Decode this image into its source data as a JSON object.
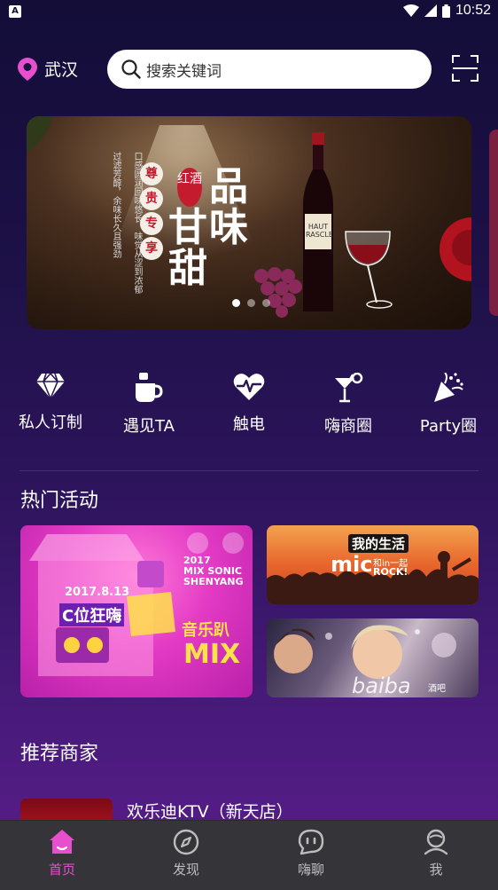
{
  "status_bar": {
    "time": "10:52",
    "notification": "A"
  },
  "header": {
    "location": "武汉",
    "search_placeholder": "搜索关键词"
  },
  "banner": {
    "tag": "红酒",
    "title_chars": [
      "品",
      "味",
      "甘",
      "甜"
    ],
    "circle_chars": [
      "尊",
      "贵",
      "专",
      "享"
    ],
    "side_text_1": "口感圆润回味悠长，味觉从涩到浓郁",
    "side_text_2": "过滤芳醇，余味长久且强劲",
    "bottle_label": "HAUT RASCLE",
    "dot_count": 3,
    "active_dot": 0
  },
  "categories": [
    {
      "label": "私人订制",
      "icon": "diamond-icon"
    },
    {
      "label": "遇见TA",
      "icon": "coffee-cup-icon"
    },
    {
      "label": "触电",
      "icon": "heartbeat-icon"
    },
    {
      "label": "嗨商圈",
      "icon": "cocktail-icon"
    },
    {
      "label": "Party圈",
      "icon": "party-popper-icon"
    }
  ],
  "hot_activities": {
    "title": "热门活动",
    "items": [
      {
        "lines": [
          "2017",
          "MIX SONIC",
          "SHENYANG"
        ],
        "date": "2017.8.13",
        "slogan": "C位狂嗨",
        "badge": "音乐趴",
        "brand": "MIX"
      },
      {
        "headline": "我的生活",
        "brand": "mic",
        "tagline": "和in一起",
        "sub": "ROCK!"
      },
      {
        "brand": "baiba",
        "sub": "酒吧"
      }
    ]
  },
  "merchants": {
    "title": "推荐商家",
    "items": [
      {
        "name": "欢乐迪KTV（新天店）"
      }
    ]
  },
  "bottom_nav": [
    {
      "label": "首页",
      "icon": "home-icon",
      "active": true
    },
    {
      "label": "发现",
      "icon": "compass-icon",
      "active": false
    },
    {
      "label": "嗨聊",
      "icon": "chat-icon",
      "active": false
    },
    {
      "label": "我",
      "icon": "user-icon",
      "active": false
    }
  ],
  "colors": {
    "accent": "#e84fcf",
    "nav_bg": "#353539",
    "bg_top": "#130d38",
    "bg_bottom": "#5a1e8c"
  }
}
